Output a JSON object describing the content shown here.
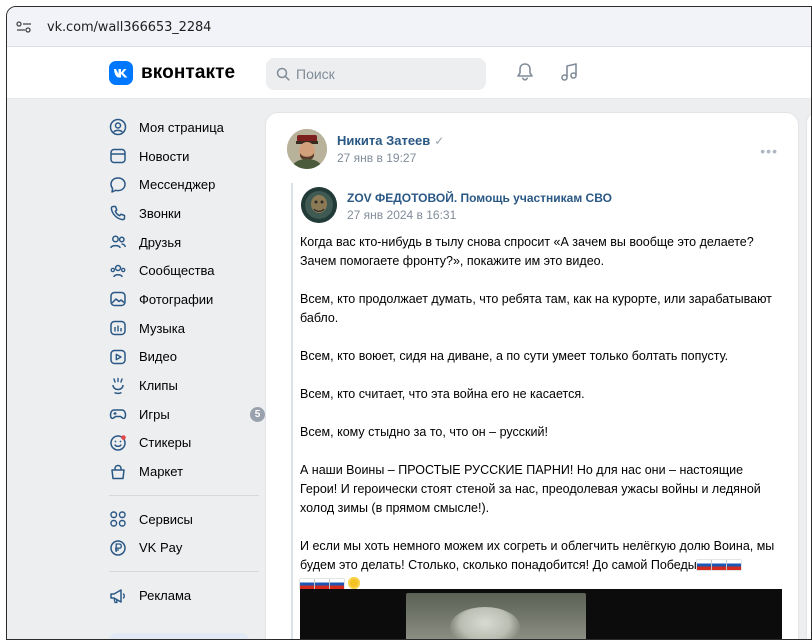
{
  "browser": {
    "url": "vk.com/wall366653_2284"
  },
  "header": {
    "logo_text": "вконтакте",
    "search_placeholder": "Поиск"
  },
  "sidebar": {
    "items": [
      {
        "label": "Моя страница",
        "icon": "user-circle-icon"
      },
      {
        "label": "Новости",
        "icon": "news-icon"
      },
      {
        "label": "Мессенджер",
        "icon": "chat-bubble-icon"
      },
      {
        "label": "Звонки",
        "icon": "phone-icon"
      },
      {
        "label": "Друзья",
        "icon": "friends-icon"
      },
      {
        "label": "Сообщества",
        "icon": "communities-icon"
      },
      {
        "label": "Фотографии",
        "icon": "photo-icon"
      },
      {
        "label": "Музыка",
        "icon": "music-icon"
      },
      {
        "label": "Видео",
        "icon": "video-icon"
      },
      {
        "label": "Клипы",
        "icon": "clips-icon"
      },
      {
        "label": "Игры",
        "icon": "gamepad-icon",
        "badge": "5"
      },
      {
        "label": "Стикеры",
        "icon": "sticker-icon"
      },
      {
        "label": "Маркет",
        "icon": "bag-icon"
      }
    ],
    "items2": [
      {
        "label": "Сервисы",
        "icon": "services-icon"
      },
      {
        "label": "VK Pay",
        "icon": "vkpay-icon"
      }
    ],
    "items3": [
      {
        "label": "Реклама",
        "icon": "megaphone-icon"
      }
    ]
  },
  "post": {
    "author": "Никита Затеев",
    "verified_mark": "✓",
    "date": "27 янв в 19:27",
    "more": "•••",
    "repost": {
      "author": "ZOV ФЕДОТОВОЙ. Помощь участникам СВО",
      "date": "27 янв 2024 в 16:31"
    },
    "paragraphs": [
      "Когда вас кто-нибудь в тылу снова спросит «А зачем вы вообще это делаете? Зачем помогаете фронту?», покажите им это видео.",
      "Всем, кто продолжает думать, что ребята там, как на курорте, или зарабатывают бабло.",
      "Всем, кто воюет, сидя на диване, а по сути умеет только болтать попусту.",
      "Всем, кто считает, что эта война его не касается.",
      "Всем, кому стыдно за то, что он – русский!",
      "А наши Воины – ПРОСТЫЕ РУССКИЕ ПАРНИ! Но для нас они – настоящие Герои! И героически стоят стеной за нас, преодолевая ужасы войны и ледяной холод зимы (в прямом смысле!).",
      "И если мы хоть немного можем их согреть и облегчить нелёгкую долю Воина, мы будем это делать! Столько, сколько понадобится! До самой Победы"
    ]
  },
  "colors": {
    "accent": "#0077ff",
    "link": "#2a5885",
    "muted": "#818c99",
    "page_bg": "#edeef0"
  }
}
